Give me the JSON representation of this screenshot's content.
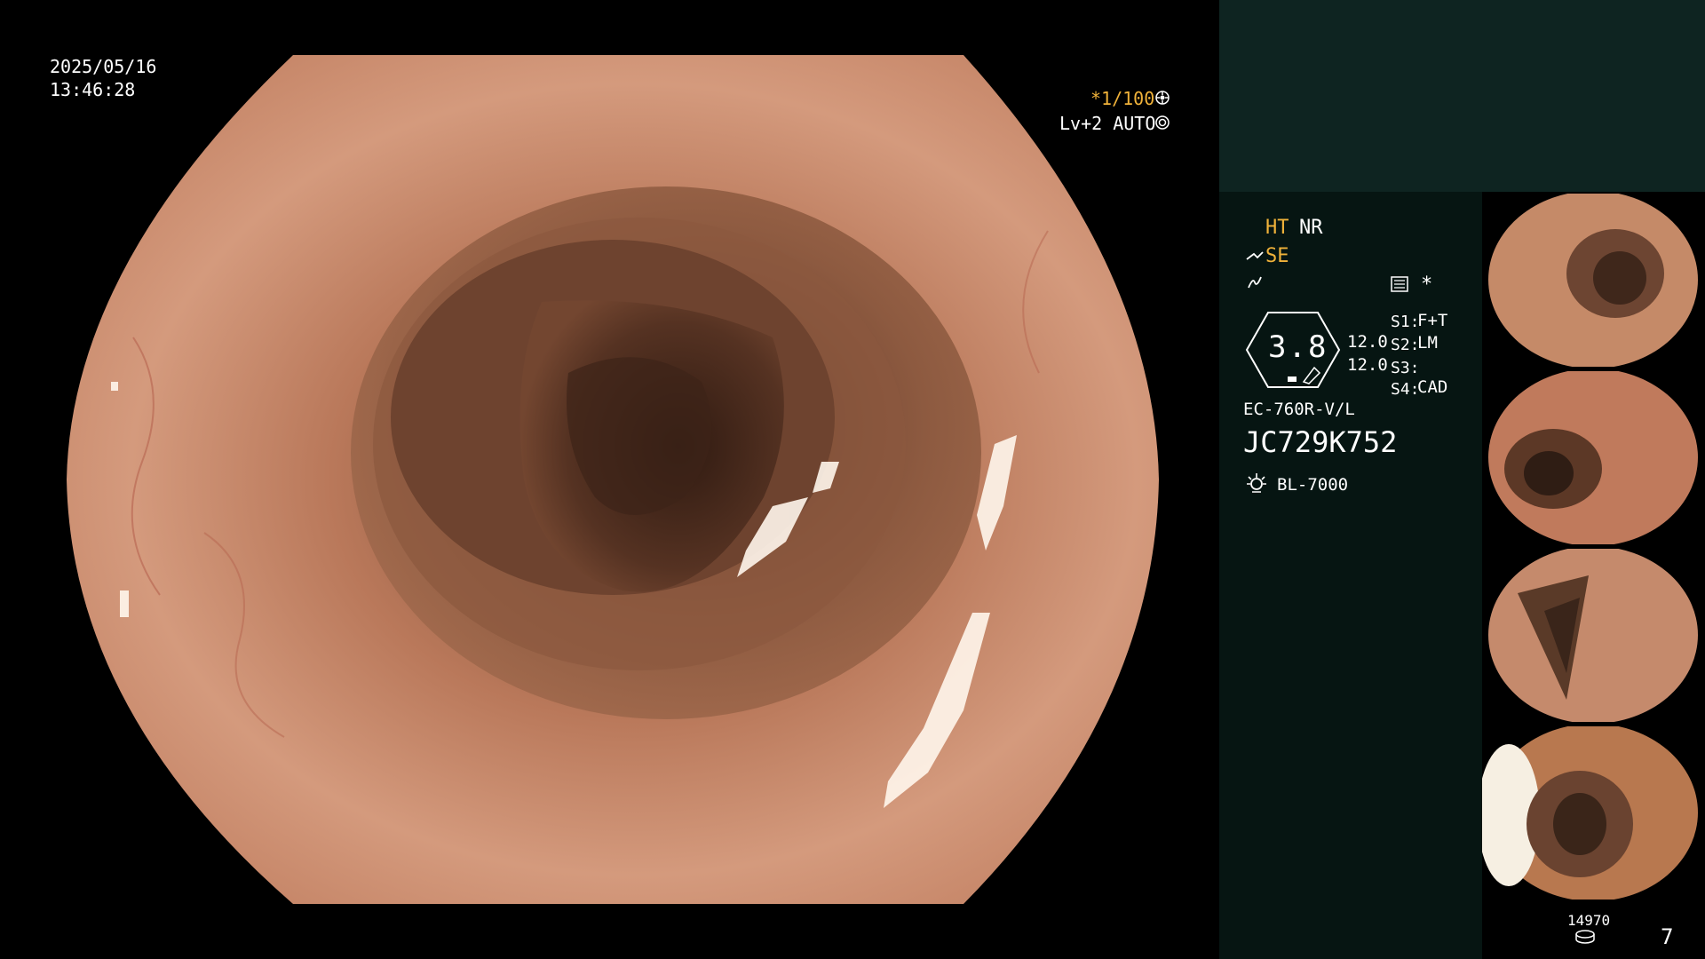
{
  "osd": {
    "date": "2025/05/16",
    "time": "13:46:28",
    "shutter": "*1/100",
    "light_level": "Lv+2 AUTO"
  },
  "panel": {
    "enhance_ht": "HT",
    "enhance_nr": "NR",
    "structure_mode": "SE",
    "zoom_value": "3.8",
    "iris_a": "12.0",
    "iris_b": "12.0",
    "s1_label": "S1:",
    "s1_value": "F+T",
    "s2_label": "S2:",
    "s2_value": "LM",
    "s3_label": "S3:",
    "s3_value": "",
    "s4_label": "S4:",
    "s4_value": "CAD",
    "asterisk": "*",
    "scope_model": "EC-760R-V/L",
    "scope_serial": "JC729K752",
    "light_source": "BL-7000",
    "storage_count": "14970",
    "image_count": "7"
  },
  "icons": [
    "gear-icon",
    "aperture-icon",
    "scope-tip-icon",
    "wave-icon",
    "list-icon",
    "lamp-icon",
    "disk-icon"
  ],
  "thumbnails": [
    {
      "name": "thumbnail-1"
    },
    {
      "name": "thumbnail-2"
    },
    {
      "name": "thumbnail-3"
    },
    {
      "name": "thumbnail-4"
    }
  ],
  "colors": {
    "tissue": "#c98a6a",
    "lumen": "#3d2418",
    "panel_teal": "#0e2421",
    "panel_dark": "#061512",
    "amber_text": "#f0b23a"
  }
}
